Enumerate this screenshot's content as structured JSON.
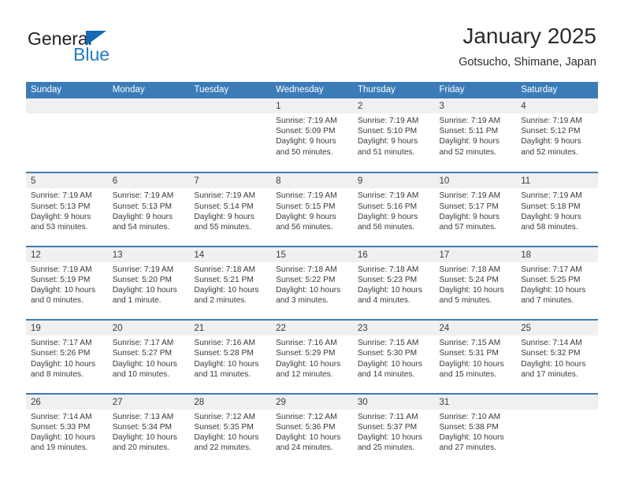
{
  "brand": {
    "name_part1": "General",
    "name_part2": "Blue",
    "triangle_color": "#156cb4",
    "blue_color": "#1f7fc4"
  },
  "header": {
    "title": "January 2025",
    "subtitle": "Gotsucho, Shimane, Japan"
  },
  "theme": {
    "header_blue": "#3b7cb8",
    "day_band_gray": "#f0f0f0",
    "text_color": "#3a3a3a"
  },
  "weekdays": [
    "Sunday",
    "Monday",
    "Tuesday",
    "Wednesday",
    "Thursday",
    "Friday",
    "Saturday"
  ],
  "weeks": [
    [
      {
        "day": "",
        "sunrise": "",
        "sunset": "",
        "daylight_line1": "",
        "daylight_line2": ""
      },
      {
        "day": "",
        "sunrise": "",
        "sunset": "",
        "daylight_line1": "",
        "daylight_line2": ""
      },
      {
        "day": "",
        "sunrise": "",
        "sunset": "",
        "daylight_line1": "",
        "daylight_line2": ""
      },
      {
        "day": "1",
        "sunrise": "Sunrise: 7:19 AM",
        "sunset": "Sunset: 5:09 PM",
        "daylight_line1": "Daylight: 9 hours",
        "daylight_line2": "and 50 minutes."
      },
      {
        "day": "2",
        "sunrise": "Sunrise: 7:19 AM",
        "sunset": "Sunset: 5:10 PM",
        "daylight_line1": "Daylight: 9 hours",
        "daylight_line2": "and 51 minutes."
      },
      {
        "day": "3",
        "sunrise": "Sunrise: 7:19 AM",
        "sunset": "Sunset: 5:11 PM",
        "daylight_line1": "Daylight: 9 hours",
        "daylight_line2": "and 52 minutes."
      },
      {
        "day": "4",
        "sunrise": "Sunrise: 7:19 AM",
        "sunset": "Sunset: 5:12 PM",
        "daylight_line1": "Daylight: 9 hours",
        "daylight_line2": "and 52 minutes."
      }
    ],
    [
      {
        "day": "5",
        "sunrise": "Sunrise: 7:19 AM",
        "sunset": "Sunset: 5:13 PM",
        "daylight_line1": "Daylight: 9 hours",
        "daylight_line2": "and 53 minutes."
      },
      {
        "day": "6",
        "sunrise": "Sunrise: 7:19 AM",
        "sunset": "Sunset: 5:13 PM",
        "daylight_line1": "Daylight: 9 hours",
        "daylight_line2": "and 54 minutes."
      },
      {
        "day": "7",
        "sunrise": "Sunrise: 7:19 AM",
        "sunset": "Sunset: 5:14 PM",
        "daylight_line1": "Daylight: 9 hours",
        "daylight_line2": "and 55 minutes."
      },
      {
        "day": "8",
        "sunrise": "Sunrise: 7:19 AM",
        "sunset": "Sunset: 5:15 PM",
        "daylight_line1": "Daylight: 9 hours",
        "daylight_line2": "and 56 minutes."
      },
      {
        "day": "9",
        "sunrise": "Sunrise: 7:19 AM",
        "sunset": "Sunset: 5:16 PM",
        "daylight_line1": "Daylight: 9 hours",
        "daylight_line2": "and 56 minutes."
      },
      {
        "day": "10",
        "sunrise": "Sunrise: 7:19 AM",
        "sunset": "Sunset: 5:17 PM",
        "daylight_line1": "Daylight: 9 hours",
        "daylight_line2": "and 57 minutes."
      },
      {
        "day": "11",
        "sunrise": "Sunrise: 7:19 AM",
        "sunset": "Sunset: 5:18 PM",
        "daylight_line1": "Daylight: 9 hours",
        "daylight_line2": "and 58 minutes."
      }
    ],
    [
      {
        "day": "12",
        "sunrise": "Sunrise: 7:19 AM",
        "sunset": "Sunset: 5:19 PM",
        "daylight_line1": "Daylight: 10 hours",
        "daylight_line2": "and 0 minutes."
      },
      {
        "day": "13",
        "sunrise": "Sunrise: 7:19 AM",
        "sunset": "Sunset: 5:20 PM",
        "daylight_line1": "Daylight: 10 hours",
        "daylight_line2": "and 1 minute."
      },
      {
        "day": "14",
        "sunrise": "Sunrise: 7:18 AM",
        "sunset": "Sunset: 5:21 PM",
        "daylight_line1": "Daylight: 10 hours",
        "daylight_line2": "and 2 minutes."
      },
      {
        "day": "15",
        "sunrise": "Sunrise: 7:18 AM",
        "sunset": "Sunset: 5:22 PM",
        "daylight_line1": "Daylight: 10 hours",
        "daylight_line2": "and 3 minutes."
      },
      {
        "day": "16",
        "sunrise": "Sunrise: 7:18 AM",
        "sunset": "Sunset: 5:23 PM",
        "daylight_line1": "Daylight: 10 hours",
        "daylight_line2": "and 4 minutes."
      },
      {
        "day": "17",
        "sunrise": "Sunrise: 7:18 AM",
        "sunset": "Sunset: 5:24 PM",
        "daylight_line1": "Daylight: 10 hours",
        "daylight_line2": "and 5 minutes."
      },
      {
        "day": "18",
        "sunrise": "Sunrise: 7:17 AM",
        "sunset": "Sunset: 5:25 PM",
        "daylight_line1": "Daylight: 10 hours",
        "daylight_line2": "and 7 minutes."
      }
    ],
    [
      {
        "day": "19",
        "sunrise": "Sunrise: 7:17 AM",
        "sunset": "Sunset: 5:26 PM",
        "daylight_line1": "Daylight: 10 hours",
        "daylight_line2": "and 8 minutes."
      },
      {
        "day": "20",
        "sunrise": "Sunrise: 7:17 AM",
        "sunset": "Sunset: 5:27 PM",
        "daylight_line1": "Daylight: 10 hours",
        "daylight_line2": "and 10 minutes."
      },
      {
        "day": "21",
        "sunrise": "Sunrise: 7:16 AM",
        "sunset": "Sunset: 5:28 PM",
        "daylight_line1": "Daylight: 10 hours",
        "daylight_line2": "and 11 minutes."
      },
      {
        "day": "22",
        "sunrise": "Sunrise: 7:16 AM",
        "sunset": "Sunset: 5:29 PM",
        "daylight_line1": "Daylight: 10 hours",
        "daylight_line2": "and 12 minutes."
      },
      {
        "day": "23",
        "sunrise": "Sunrise: 7:15 AM",
        "sunset": "Sunset: 5:30 PM",
        "daylight_line1": "Daylight: 10 hours",
        "daylight_line2": "and 14 minutes."
      },
      {
        "day": "24",
        "sunrise": "Sunrise: 7:15 AM",
        "sunset": "Sunset: 5:31 PM",
        "daylight_line1": "Daylight: 10 hours",
        "daylight_line2": "and 15 minutes."
      },
      {
        "day": "25",
        "sunrise": "Sunrise: 7:14 AM",
        "sunset": "Sunset: 5:32 PM",
        "daylight_line1": "Daylight: 10 hours",
        "daylight_line2": "and 17 minutes."
      }
    ],
    [
      {
        "day": "26",
        "sunrise": "Sunrise: 7:14 AM",
        "sunset": "Sunset: 5:33 PM",
        "daylight_line1": "Daylight: 10 hours",
        "daylight_line2": "and 19 minutes."
      },
      {
        "day": "27",
        "sunrise": "Sunrise: 7:13 AM",
        "sunset": "Sunset: 5:34 PM",
        "daylight_line1": "Daylight: 10 hours",
        "daylight_line2": "and 20 minutes."
      },
      {
        "day": "28",
        "sunrise": "Sunrise: 7:12 AM",
        "sunset": "Sunset: 5:35 PM",
        "daylight_line1": "Daylight: 10 hours",
        "daylight_line2": "and 22 minutes."
      },
      {
        "day": "29",
        "sunrise": "Sunrise: 7:12 AM",
        "sunset": "Sunset: 5:36 PM",
        "daylight_line1": "Daylight: 10 hours",
        "daylight_line2": "and 24 minutes."
      },
      {
        "day": "30",
        "sunrise": "Sunrise: 7:11 AM",
        "sunset": "Sunset: 5:37 PM",
        "daylight_line1": "Daylight: 10 hours",
        "daylight_line2": "and 25 minutes."
      },
      {
        "day": "31",
        "sunrise": "Sunrise: 7:10 AM",
        "sunset": "Sunset: 5:38 PM",
        "daylight_line1": "Daylight: 10 hours",
        "daylight_line2": "and 27 minutes."
      },
      {
        "day": "",
        "sunrise": "",
        "sunset": "",
        "daylight_line1": "",
        "daylight_line2": ""
      }
    ]
  ]
}
